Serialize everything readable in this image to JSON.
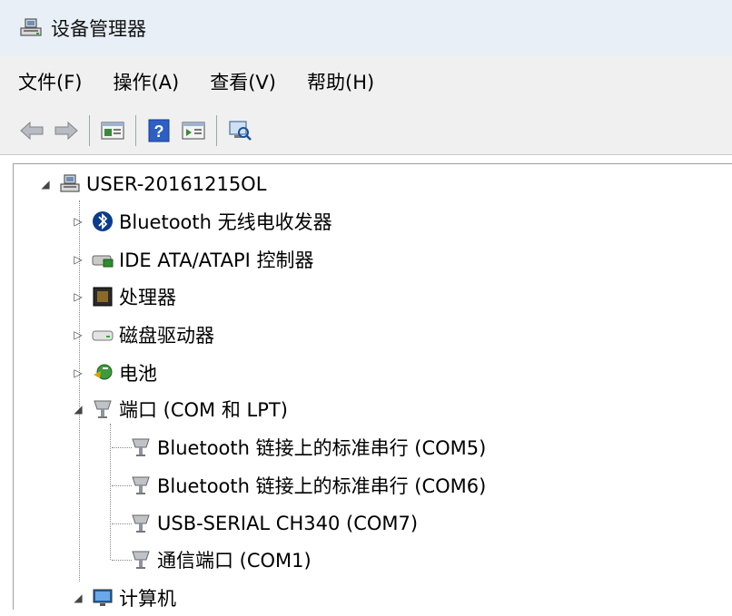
{
  "window": {
    "title": "设备管理器"
  },
  "menu": {
    "items": [
      "文件(F)",
      "操作(A)",
      "查看(V)",
      "帮助(H)"
    ]
  },
  "toolbar": {
    "buttons": [
      "back-icon",
      "forward-icon",
      "properties-icon",
      "help-icon",
      "view-icon",
      "scan-hardware-icon"
    ]
  },
  "tree": {
    "root": {
      "label": "USER-20161215OL",
      "icon": "computer-icon",
      "expanded": true
    },
    "categories": [
      {
        "label": "Bluetooth 无线电收发器",
        "icon": "bluetooth-icon",
        "expanded": false
      },
      {
        "label": "IDE ATA/ATAPI 控制器",
        "icon": "ide-controller-icon",
        "expanded": false
      },
      {
        "label": "处理器",
        "icon": "processor-icon",
        "expanded": false
      },
      {
        "label": "磁盘驱动器",
        "icon": "disk-drive-icon",
        "expanded": false
      },
      {
        "label": "电池",
        "icon": "battery-icon",
        "expanded": false
      },
      {
        "label": "端口 (COM 和 LPT)",
        "icon": "port-icon",
        "expanded": true
      },
      {
        "label": "计算机",
        "icon": "computer-monitor-icon",
        "expanded": true
      }
    ],
    "ports": [
      {
        "label": "Bluetooth 链接上的标准串行 (COM5)",
        "icon": "port-icon"
      },
      {
        "label": "Bluetooth 链接上的标准串行 (COM6)",
        "icon": "port-icon"
      },
      {
        "label": "USB-SERIAL CH340 (COM7)",
        "icon": "port-icon"
      },
      {
        "label": "通信端口 (COM1)",
        "icon": "port-icon"
      }
    ]
  }
}
